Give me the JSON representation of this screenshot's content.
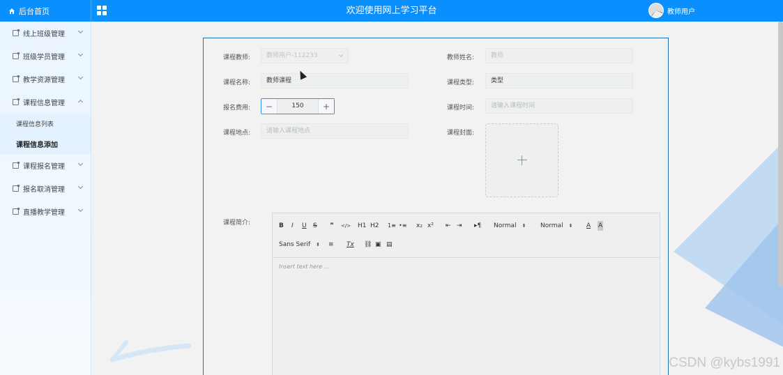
{
  "header": {
    "brand": "后台首页",
    "title": "欢迎使用网上学习平台",
    "user": "教师用户"
  },
  "sidebar": {
    "items": [
      {
        "label": "线上班级管理"
      },
      {
        "label": "班级学员管理"
      },
      {
        "label": "教学资源管理"
      },
      {
        "label": "课程信息管理",
        "expanded": true,
        "children": [
          {
            "label": "课程信息列表"
          },
          {
            "label": "课程信息添加",
            "active": true
          }
        ]
      },
      {
        "label": "课程报名管理"
      },
      {
        "label": "报名取消管理"
      },
      {
        "label": "直播教学管理"
      }
    ]
  },
  "form": {
    "teacher": {
      "label": "课程教师:",
      "value": "教师用户-112233"
    },
    "teacher_name": {
      "label": "教师姓名:",
      "value": "教师"
    },
    "course_name": {
      "label": "课程名称:",
      "value": "教师课程"
    },
    "course_type": {
      "label": "课程类型:",
      "value": "类型"
    },
    "fee": {
      "label": "报名费用:",
      "value": "150",
      "minus": "−",
      "plus": "+"
    },
    "course_time": {
      "label": "课程时间:",
      "placeholder": "请输入课程时间"
    },
    "location": {
      "label": "课程地点:",
      "placeholder": "请输入课程地点"
    },
    "cover": {
      "label": "课程封面:"
    },
    "intro": {
      "label": "课程简介:"
    }
  },
  "editor": {
    "toolbar": {
      "bold": "B",
      "italic": "I",
      "underline": "U",
      "strike": "S",
      "quote": "”",
      "code": "</>",
      "h1": "H1",
      "h2": "H2",
      "ol": "1≡",
      "ul": "•≡",
      "sub": "x₂",
      "sup": "x²",
      "outdent": "⇤",
      "indent": "⇥",
      "rtl": "▸¶",
      "size1": "Normal",
      "size2": "Normal",
      "color": "A",
      "bg": "A",
      "font": "Sans Serif",
      "align": "≡",
      "clean": "Tx",
      "link": "⛓",
      "image": "▣",
      "video": "▤"
    },
    "placeholder": "Insert text here ..."
  },
  "watermark": "CSDN @kybs1991",
  "colors": {
    "primary": "#0a8fff",
    "border": "#1f6fb7"
  }
}
